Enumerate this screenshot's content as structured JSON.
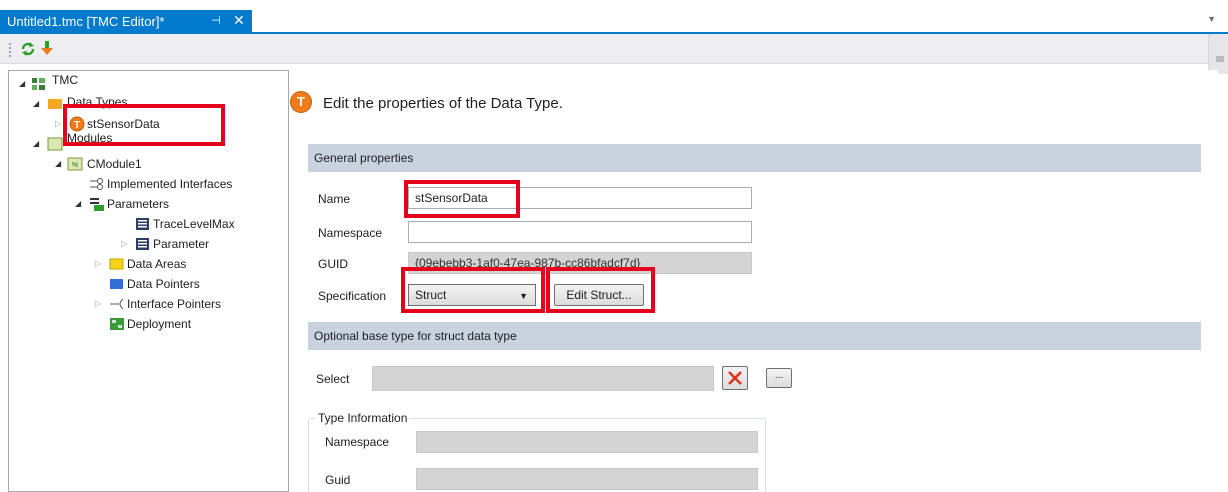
{
  "tab": {
    "title": "Untitled1.tmc [TMC Editor]*",
    "pin_glyph": "⊣",
    "close_glyph": "✕",
    "dropdown_glyph": "▼"
  },
  "toolbar": {
    "reload_icon": "reload-icon",
    "add_icon": "add-arrow-icon"
  },
  "tree": {
    "root": "TMC",
    "data_types": "Data Types",
    "st_sensor_data": "stSensorData",
    "modules": "Modules",
    "cmodule1": "CModule1",
    "implemented_interfaces": "Implemented Interfaces",
    "parameters": "Parameters",
    "trace_level_max": "TraceLevelMax",
    "parameter": "Parameter",
    "data_areas": "Data Areas",
    "data_pointers": "Data Pointers",
    "interface_pointers": "Interface Pointers",
    "deployment": "Deployment"
  },
  "editor": {
    "badge": "T",
    "header": "Edit the properties of the Data Type.",
    "general_section": "General properties",
    "name_label": "Name",
    "name_value": "stSensorData",
    "namespace_label": "Namespace",
    "namespace_value": "",
    "guid_label": "GUID",
    "guid_value": "{09ebebb3-1af0-47ea-987b-cc86bfadcf7d}",
    "spec_label": "Specification",
    "spec_value": "Struct",
    "edit_struct_button": "Edit Struct...",
    "base_section": "Optional base type for struct data type",
    "select_label": "Select",
    "select_value": "",
    "browse_button": "...",
    "type_info_legend": "Type Information",
    "ti_namespace_label": "Namespace",
    "ti_namespace_value": "",
    "ti_guid_label": "Guid",
    "ti_guid_value": ""
  },
  "colors": {
    "accent": "#007acc",
    "section": "#c9d3e0",
    "highlight": "#e5001c",
    "badge": "#f07b1a"
  }
}
